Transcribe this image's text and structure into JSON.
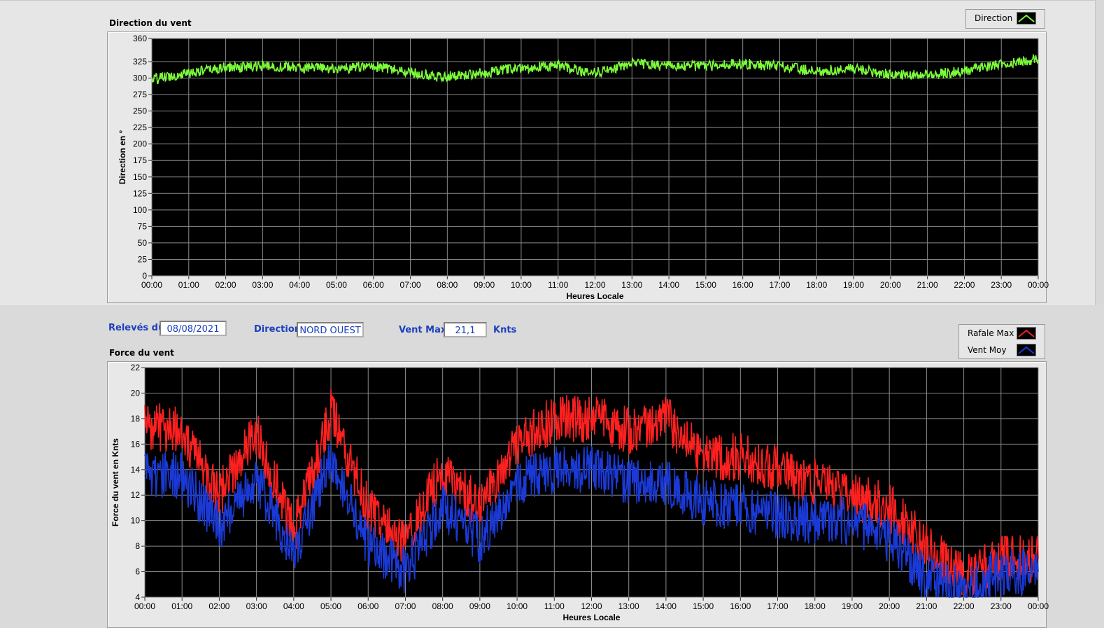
{
  "direction_panel": {
    "title": "Direction du vent",
    "legend": {
      "label": "Direction",
      "color": "#7cfc3a"
    }
  },
  "info_bar": {
    "releves_label": "Relevés du",
    "releves_value": "08/08/2021",
    "direction_label": "Direction",
    "direction_value": "NORD OUEST",
    "ventmax_label": "Vent Max",
    "ventmax_value": "21,1",
    "ventmax_unit": "Knts"
  },
  "force_panel": {
    "title": "Force du vent",
    "legend": [
      {
        "label": "Rafale Max",
        "color": "#ff2020"
      },
      {
        "label": "Vent Moy",
        "color": "#1a3ad8"
      }
    ]
  },
  "chart_data": [
    {
      "type": "line",
      "x": [
        "00:00",
        "01:00",
        "02:00",
        "03:00",
        "04:00",
        "05:00",
        "06:00",
        "07:00",
        "08:00",
        "09:00",
        "10:00",
        "11:00",
        "12:00",
        "13:00",
        "14:00",
        "15:00",
        "16:00",
        "17:00",
        "18:00",
        "19:00",
        "20:00",
        "21:00",
        "22:00",
        "23:00",
        "00:00"
      ],
      "series": [
        {
          "name": "Direction",
          "color": "#7cfc3a",
          "values": [
            298,
            308,
            316,
            318,
            316,
            314,
            318,
            308,
            302,
            308,
            316,
            318,
            308,
            322,
            318,
            318,
            322,
            318,
            310,
            315,
            305,
            305,
            310,
            322,
            328
          ]
        }
      ],
      "xlabel": "Heures Locale",
      "ylabel": "Direction en °",
      "ylim": [
        0,
        360
      ],
      "yticks": [
        0,
        25,
        50,
        75,
        100,
        125,
        150,
        175,
        200,
        225,
        250,
        275,
        300,
        325,
        360
      ],
      "grid": true
    },
    {
      "type": "line",
      "x": [
        "00:00",
        "01:00",
        "02:00",
        "03:00",
        "04:00",
        "05:00",
        "06:00",
        "07:00",
        "08:00",
        "09:00",
        "10:00",
        "11:00",
        "12:00",
        "13:00",
        "14:00",
        "15:00",
        "16:00",
        "17:00",
        "18:00",
        "19:00",
        "20:00",
        "21:00",
        "22:00",
        "23:00",
        "00:00"
      ],
      "series": [
        {
          "name": "Rafale Max",
          "color": "#ff2020",
          "values": [
            17.5,
            17,
            12,
            17,
            9,
            18.5,
            11,
            8,
            14,
            11,
            16,
            18,
            18,
            17,
            18,
            15,
            15,
            14,
            13,
            12,
            11,
            8,
            5.5,
            7,
            7
          ]
        },
        {
          "name": "Vent Moy",
          "color": "#1a3ad8",
          "values": [
            13.5,
            13.5,
            9.5,
            13,
            7.5,
            15,
            8,
            6,
            11,
            8.5,
            13,
            14,
            14,
            13,
            13,
            11.5,
            11,
            10.5,
            10,
            10,
            8.5,
            5.5,
            4.5,
            6,
            6
          ]
        }
      ],
      "xlabel": "Heures Locale",
      "ylabel": "Force du vent en Knts",
      "ylim": [
        4,
        22
      ],
      "yticks": [
        4,
        6,
        8,
        10,
        12,
        14,
        16,
        18,
        20,
        22
      ],
      "grid": true
    }
  ]
}
